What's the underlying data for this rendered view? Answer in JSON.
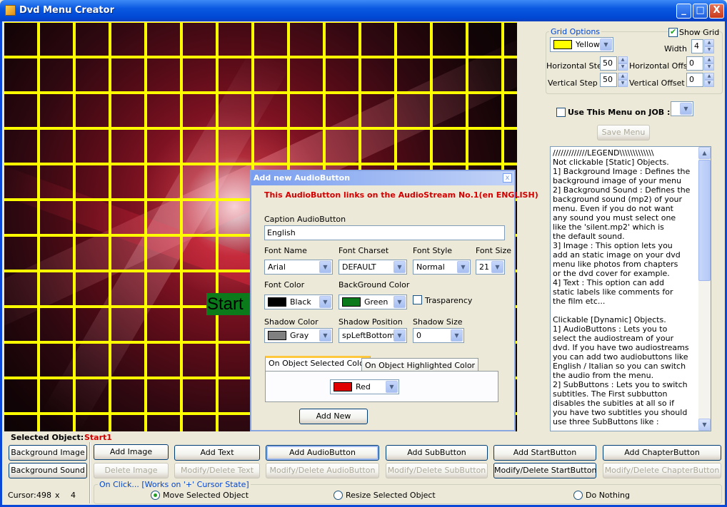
{
  "window": {
    "title": "Dvd Menu Creator",
    "minimize": "_",
    "maximize": "□",
    "close": "X"
  },
  "canvas": {
    "start_object_caption": "Start"
  },
  "grid_options": {
    "legend": "Grid Options",
    "color": "Yellow",
    "color_hex": "#ffff00",
    "show_grid_label": "Show Grid",
    "show_grid": true,
    "width_label": "Width",
    "width": "4",
    "h_step_label": "Horizontal Step",
    "h_step": "50",
    "h_offset_label": "Horizontal Offset",
    "h_offset": "0",
    "v_step_label": "Vertical Step",
    "v_step": "50",
    "v_offset_label": "Vertical Offset",
    "v_offset": "0"
  },
  "job": {
    "use_label": "Use This Menu on JOB :",
    "value": "",
    "save_menu": "Save Menu"
  },
  "legend_text": [
    "/////////////LEGEND\\\\\\\\\\\\\\\\\\\\\\\\\\",
    "Not clickable [Static] Objects.",
    "1] Background Image : Defines the",
    "background image of your menu",
    "2] Background Sound : Defines the",
    "background sound (mp2) of your",
    "menu. Even if you do not want",
    "any sound you must select one",
    "like the 'silent.mp2' which is",
    "the default sound.",
    "3] Image : This option lets you",
    "add an static image on your dvd",
    "menu like photos from chapters",
    "or the dvd cover for example.",
    "4] Text : This option can add",
    "static labels like comments for",
    "the film etc...",
    "",
    "Clickable [Dynamic] Objects.",
    "1] AudioButtons : Lets you to",
    "select the audiostream of your",
    "dvd. If you have two audiostreams",
    "you can add two audiobuttons like",
    "English / Italian so you can switch",
    "the audio from the menu.",
    "2] SubButtons : Lets you to switch",
    "subtitles. The First subbutton",
    "disables the subitles at all so if",
    "you have two subtitles you should",
    "use three SubButtons like :"
  ],
  "dialog": {
    "title": "Add new AudioButton",
    "close": "x",
    "link_text": "This AudioButton links on the AudioStream No.1(en ENGLISH)",
    "caption_label": "Caption AudioButton",
    "caption_value": "English",
    "font_name_label": "Font Name",
    "font_name": "Arial",
    "font_charset_label": "Font Charset",
    "font_charset": "DEFAULT",
    "font_style_label": "Font Style",
    "font_style": "Normal",
    "font_size_label": "Font Size",
    "font_size": "21",
    "font_color_label": "Font Color",
    "font_color": "Black",
    "font_color_hex": "#000000",
    "bg_color_label": "BackGround Color",
    "bg_color": "Green",
    "bg_color_hex": "#0a7a1a",
    "transparency_label": "Trasparency",
    "shadow_color_label": "Shadow Color",
    "shadow_color": "Gray",
    "shadow_color_hex": "#808080",
    "shadow_position_label": "Shadow Position",
    "shadow_position": "spLeftBottom",
    "shadow_size_label": "Shadow Size",
    "shadow_size": "0",
    "tab_selected": "On Object Selected Color",
    "tab_highlighted": "On Object Highlighted Color",
    "selected_color": "Red",
    "selected_color_hex": "#e00000",
    "add_new": "Add New"
  },
  "bottom": {
    "selected_object_label": "Selected Object:",
    "selected_object": "Start1",
    "background_image": "Background Image",
    "background_sound": "Background Sound",
    "cursor_label": "Cursor:",
    "cursor_x": "498",
    "cursor_sep": "x",
    "cursor_y": "4",
    "add_image": "Add Image",
    "delete_image": "Delete Image",
    "add_text": "Add Text",
    "modify_text": "Modify/Delete Text",
    "add_audio": "Add AudioButton",
    "modify_audio": "Modify/Delete AudioButton",
    "add_sub": "Add SubButton",
    "modify_sub": "Modify/Delete SubButton",
    "add_start": "Add StartButton",
    "modify_start": "Modify/Delete StartButton",
    "add_chapter": "Add ChapterButton",
    "modify_chapter": "Modify/Delete ChapterButton",
    "onclick_legend": "On Click... [Works on '+' Cursor State]",
    "move": "Move Selected Object",
    "resize": "Resize Selected Object",
    "nothing": "Do Nothing"
  }
}
